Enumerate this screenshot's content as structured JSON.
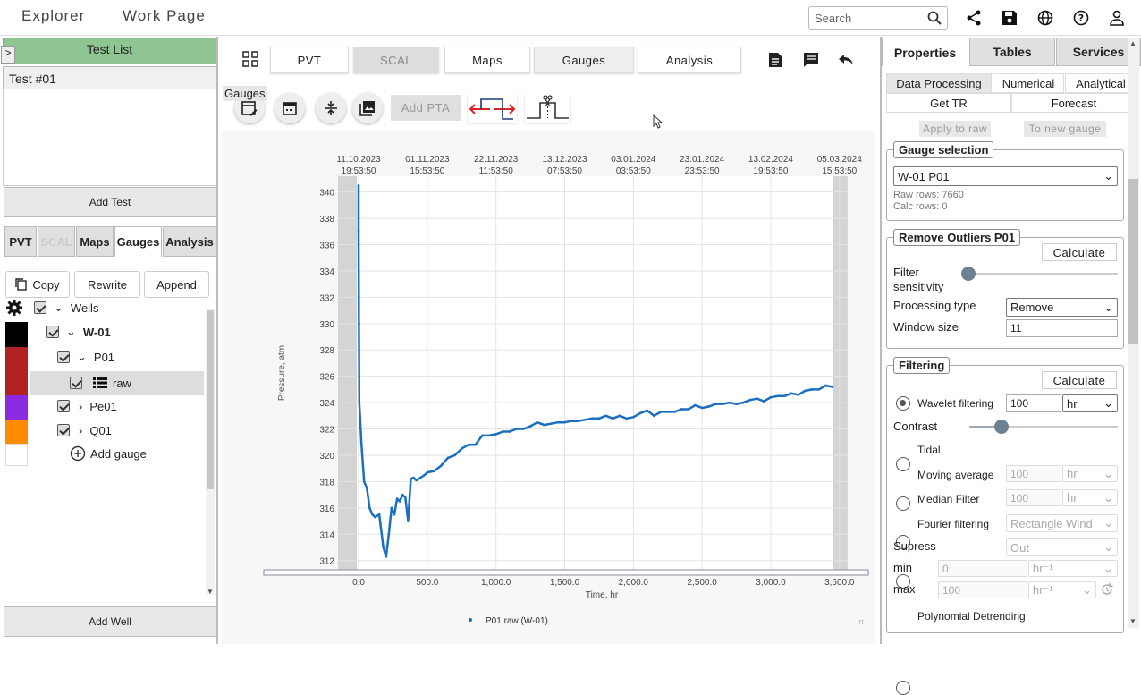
{
  "topbar": {
    "tabs": [
      "Explorer",
      "Work Page"
    ],
    "search_placeholder": "Search"
  },
  "left": {
    "header": "Test List",
    "collapse_glyph": ">",
    "test_item": "Test #01",
    "add_test": "Add Test",
    "tabs": [
      "PVT",
      "SCAL",
      "Maps",
      "Gauges",
      "Analysis"
    ],
    "buttons": {
      "copy": "Copy",
      "rewrite": "Rewrite",
      "append": "Append"
    },
    "tree": {
      "wells": "Wells",
      "w01": "W-01",
      "p01": "P01",
      "raw": "raw",
      "pe01": "Pe01",
      "q01": "Q01",
      "add_gauge": "Add gauge"
    },
    "add_well": "Add Well",
    "swatch_colors": [
      "#000000",
      "#b22222",
      "#b22222",
      "#8a2be2",
      "#ff8c00",
      "#ffffff"
    ]
  },
  "center": {
    "tabs": [
      "PVT",
      "SCAL",
      "Maps",
      "Gauges",
      "Analysis"
    ],
    "tooltip": "Gauges",
    "add_pta": "Add PTA"
  },
  "chart_data": {
    "type": "line",
    "title": "",
    "xlabel": "Time, hr",
    "ylabel": "Pressure, atm",
    "xlim": [
      -150,
      3560
    ],
    "ylim": [
      311.3,
      341.2
    ],
    "x_ticks": [
      0,
      500,
      1000,
      1500,
      2000,
      2500,
      3000,
      3500
    ],
    "x_tick_labels": [
      "0.0",
      "500.0",
      "1,000.0",
      "1,500.0",
      "2,000.0",
      "2,500.0",
      "3,000.0",
      "3,500.0"
    ],
    "y_ticks": [
      312,
      314,
      316,
      318,
      320,
      322,
      324,
      326,
      328,
      330,
      332,
      334,
      336,
      338,
      340
    ],
    "top_axis_labels": [
      [
        "11.10.2023",
        "19:53:50"
      ],
      [
        "01.11.2023",
        "15:53:50"
      ],
      [
        "22.11.2023",
        "11:53:50"
      ],
      [
        "13.12.2023",
        "07:53:50"
      ],
      [
        "03.01.2024",
        "03:53:50"
      ],
      [
        "23.01.2024",
        "23:53:50"
      ],
      [
        "13.02.2024",
        "19:53:50"
      ],
      [
        "05.03.2024",
        "15:53:50"
      ]
    ],
    "legend": "P01 raw (W-01)",
    "series": [
      {
        "name": "P01 raw (W-01)",
        "color": "#1a6fbf",
        "x": [
          0,
          0,
          2,
          5,
          10,
          20,
          40,
          60,
          80,
          100,
          120,
          150,
          180,
          200,
          220,
          240,
          260,
          280,
          300,
          320,
          340,
          360,
          380,
          400,
          420,
          450,
          480,
          500,
          550,
          600,
          650,
          700,
          750,
          800,
          850,
          900,
          950,
          1000,
          1050,
          1100,
          1150,
          1200,
          1250,
          1300,
          1350,
          1400,
          1450,
          1500,
          1550,
          1600,
          1650,
          1700,
          1750,
          1800,
          1850,
          1900,
          1950,
          2000,
          2050,
          2100,
          2150,
          2200,
          2250,
          2300,
          2350,
          2400,
          2450,
          2500,
          2550,
          2600,
          2650,
          2700,
          2750,
          2800,
          2850,
          2900,
          2950,
          3000,
          3050,
          3100,
          3150,
          3200,
          3250,
          3300,
          3350,
          3400,
          3450
        ],
        "y": [
          340.5,
          337,
          330,
          324,
          323,
          321,
          318,
          317.5,
          316,
          315.5,
          315.3,
          315.5,
          313,
          312.3,
          314,
          316,
          315.5,
          316.7,
          316.5,
          317,
          316.8,
          315,
          318.2,
          318.3,
          318.1,
          318.3,
          318.5,
          318.7,
          318.8,
          319.2,
          319.8,
          320,
          320.5,
          320.8,
          320.8,
          321.5,
          321.5,
          321.6,
          321.8,
          321.8,
          322,
          322,
          322.2,
          322.5,
          322.3,
          322.4,
          322.5,
          322.5,
          322.6,
          322.6,
          322.7,
          322.8,
          322.8,
          323,
          322.8,
          323,
          322.8,
          322.9,
          323.2,
          323.4,
          323,
          323.3,
          323.3,
          323.3,
          323.5,
          323.5,
          323.8,
          323.6,
          323.7,
          323.9,
          323.9,
          324,
          323.9,
          324,
          324.2,
          324.3,
          324.1,
          324.4,
          324.5,
          324.5,
          324.7,
          324.6,
          324.9,
          325,
          325,
          325.3,
          325.2
        ]
      }
    ]
  },
  "right": {
    "tabs": [
      "Properties",
      "Tables",
      "Services"
    ],
    "subtabs1": [
      "Data Processing",
      "Numerical",
      "Analytical"
    ],
    "subtabs2": [
      "Get TR",
      "Forecast"
    ],
    "apply_raw": "Apply to raw",
    "to_new_gauge": "To new gauge",
    "gauge_selection": {
      "title": "Gauge selection",
      "value": "W-01 P01",
      "raw_rows": "Raw rows: 7660",
      "calc_rows": "Calc rows: 0"
    },
    "outliers": {
      "title": "Remove Outliers P01",
      "calculate": "Calculate",
      "filter_sensitivity": "Filter sensitivity",
      "processing_type_label": "Processing type",
      "processing_type": "Remove",
      "window_size_label": "Window size",
      "window_size": "11"
    },
    "filtering": {
      "title": "Filtering",
      "calculate": "Calculate",
      "wavelet": "Wavelet filtering",
      "wavelet_value": "100",
      "wavelet_unit": "hr",
      "contrast": "Contrast",
      "tidal": "Tidal",
      "moving_average": "Moving average",
      "ma_value": "100",
      "ma_unit": "hr",
      "median": "Median Filter",
      "median_value": "100",
      "median_unit": "hr",
      "fourier": "Fourier filtering",
      "fourier_option": "Rectangle Wind",
      "supress": "Supress",
      "supress_option": "Out",
      "min": "min",
      "min_value": "0",
      "min_unit": "hr⁻¹",
      "max": "max",
      "max_value": "100",
      "max_unit": "hr⁻¹",
      "polynomial": "Polynomial Detrending"
    }
  }
}
